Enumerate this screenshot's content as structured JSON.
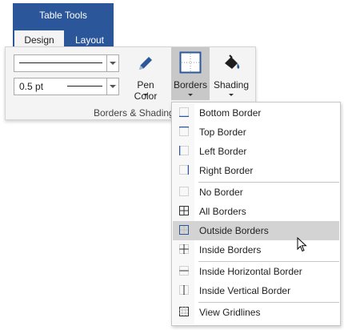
{
  "table_tools": {
    "title": "Table Tools",
    "tabs": [
      {
        "label": "Design"
      },
      {
        "label": "Layout"
      }
    ],
    "color": "#2b579a"
  },
  "ribbon": {
    "line_weight": "0.5 pt",
    "pen_color_label": "Pen Color",
    "borders_label": "Borders",
    "shading_label": "Shading",
    "group_label": "Borders & Shadings",
    "pen_color": "#2b579a"
  },
  "borders_menu": {
    "items": [
      {
        "label": "Bottom Border",
        "icon": "bottom-border-icon"
      },
      {
        "label": "Top Border",
        "icon": "top-border-icon"
      },
      {
        "label": "Left Border",
        "icon": "left-border-icon"
      },
      {
        "label": "Right Border",
        "icon": "right-border-icon"
      },
      {
        "label": "No Border",
        "icon": "no-border-icon"
      },
      {
        "label": "All Borders",
        "icon": "all-borders-icon"
      },
      {
        "label": "Outside Borders",
        "icon": "outside-borders-icon",
        "highlighted": true
      },
      {
        "label": "Inside Borders",
        "icon": "inside-borders-icon"
      },
      {
        "label": "Inside Horizontal Border",
        "icon": "inside-horizontal-border-icon"
      },
      {
        "label": "Inside Vertical Border",
        "icon": "inside-vertical-border-icon"
      },
      {
        "label": "View Gridlines",
        "icon": "view-gridlines-icon"
      }
    ],
    "highlight_color": "#d3d3d3"
  }
}
